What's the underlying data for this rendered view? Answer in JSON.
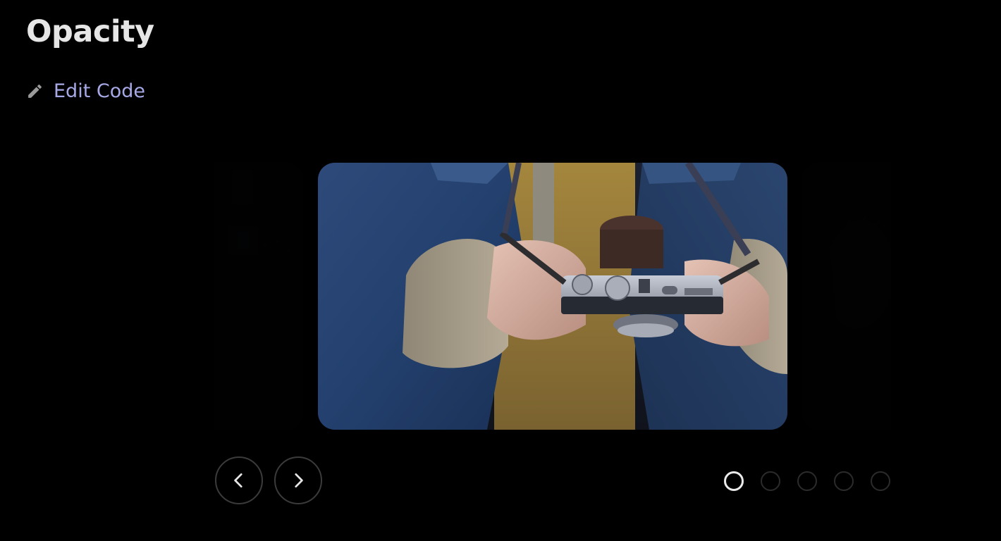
{
  "header": {
    "title": "Opacity"
  },
  "edit": {
    "label": "Edit Code",
    "icon": "pencil-icon"
  },
  "carousel": {
    "slides": [
      {
        "name": "slide-previous",
        "opacity": 0.1,
        "active": false
      },
      {
        "name": "slide-current",
        "description_icon": "camera-photo",
        "opacity": 1,
        "active": true
      },
      {
        "name": "slide-next",
        "opacity": 0.1,
        "active": false
      }
    ],
    "prev_button_icon": "chevron-left-icon",
    "next_button_icon": "chevron-right-icon",
    "dot_count": 5,
    "active_index": 0
  },
  "colors": {
    "background": "#000000",
    "title": "#e6e6e6",
    "link": "#a7a9e6",
    "button_border": "#3b3b3b",
    "dot_active": "#eaeaea",
    "dot_inactive": "#2b2b2b"
  }
}
